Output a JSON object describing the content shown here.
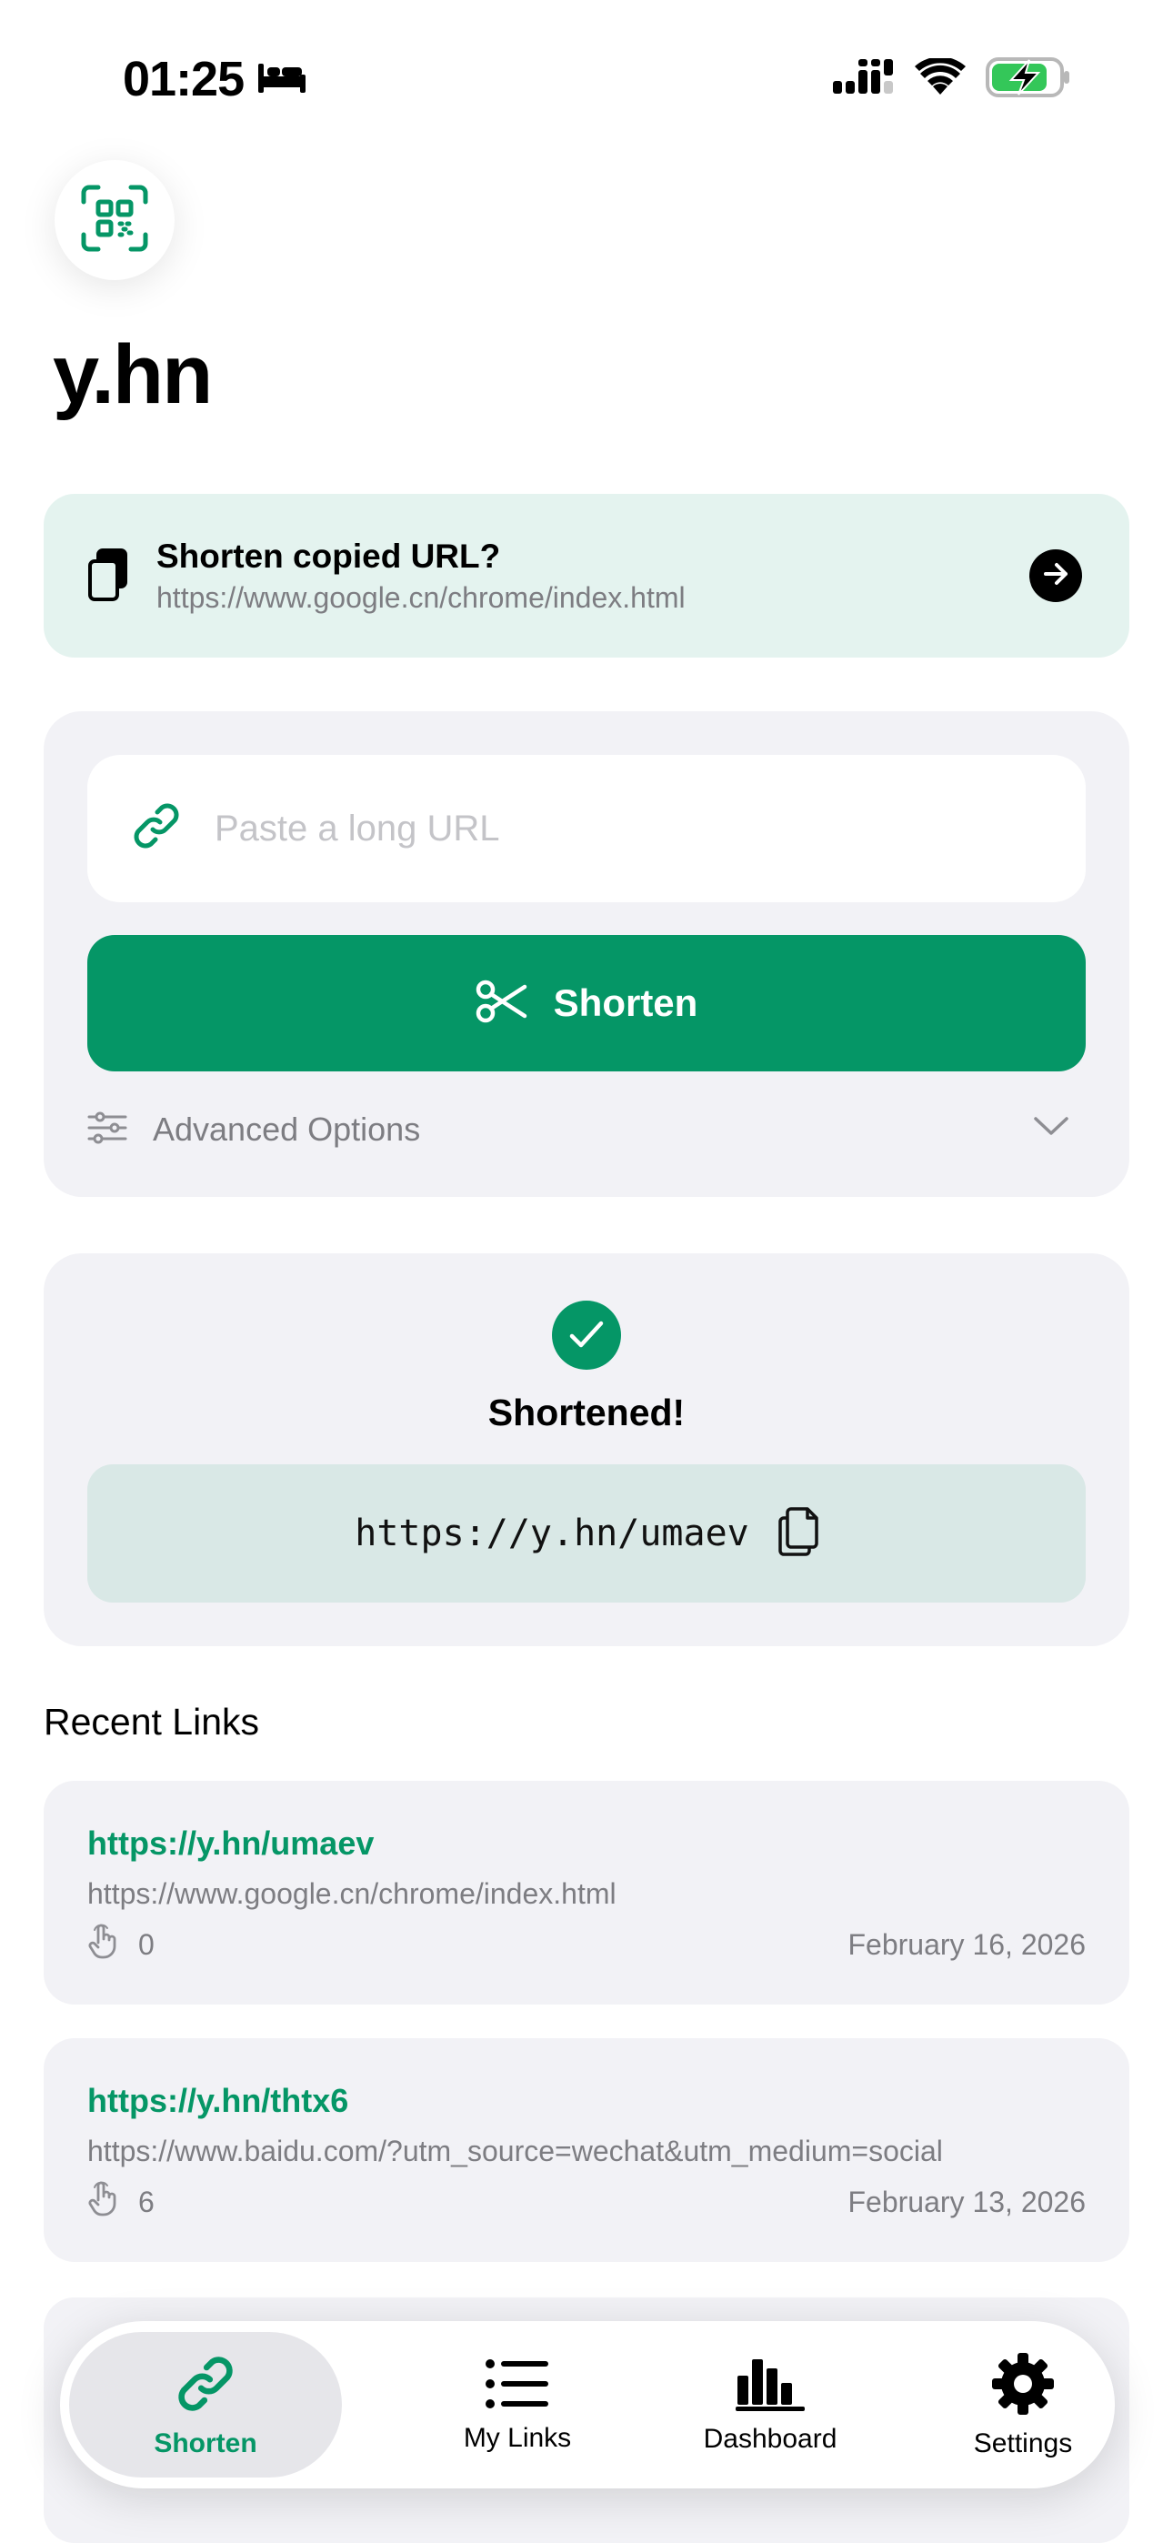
{
  "status_bar": {
    "time": "01:25"
  },
  "app": {
    "title": "y.hn"
  },
  "clipboard_banner": {
    "title": "Shorten copied URL?",
    "url": "https://www.google.cn/chrome/index.html"
  },
  "shorten_form": {
    "placeholder": "Paste a long URL",
    "value": "",
    "button_label": "Shorten",
    "advanced_label": "Advanced Options"
  },
  "result": {
    "title": "Shortened!",
    "short_url": "https://y.hn/umaev"
  },
  "recent": {
    "title": "Recent Links",
    "items": [
      {
        "short": "https://y.hn/umaev",
        "original": "https://www.google.cn/chrome/index.html",
        "clicks": "0",
        "date": "February 16, 2026"
      },
      {
        "short": "https://y.hn/thtx6",
        "original": "https://www.baidu.com/?utm_source=wechat&utm_medium=social",
        "clicks": "6",
        "date": "February 13, 2026"
      }
    ]
  },
  "tabs": [
    {
      "label": "Shorten",
      "icon": "link-icon",
      "active": true
    },
    {
      "label": "My Links",
      "icon": "list-icon",
      "active": false
    },
    {
      "label": "Dashboard",
      "icon": "chart-icon",
      "active": false
    },
    {
      "label": "Settings",
      "icon": "gear-icon",
      "active": false
    }
  ],
  "colors": {
    "accent": "#059666",
    "banner": "#e4f3ef",
    "card": "#f2f2f6",
    "result_box": "#d9e8e6"
  }
}
